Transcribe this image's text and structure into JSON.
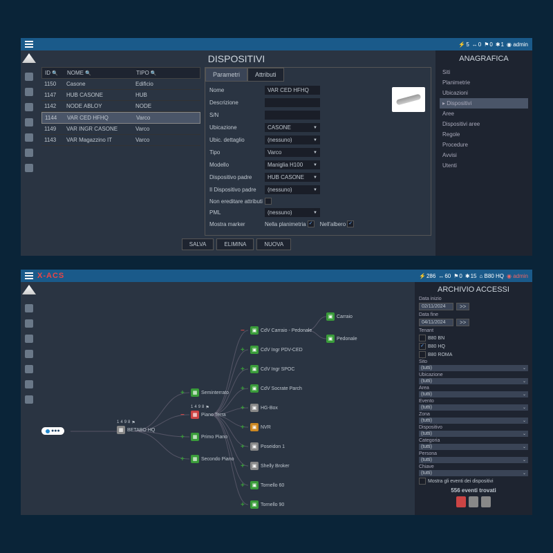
{
  "panel1": {
    "title": "DISPOSITIVI",
    "stats": {
      "b": "5",
      "s": "0",
      "f": "0",
      "e": "1"
    },
    "user": "admin",
    "table": {
      "cols": [
        "ID",
        "NOME",
        "TIPO"
      ],
      "rows": [
        {
          "id": "1150",
          "name": "Casone",
          "type": "Edificio"
        },
        {
          "id": "1147",
          "name": "HUB CASONE",
          "type": "HUB"
        },
        {
          "id": "1142",
          "name": "NODE ABLOY",
          "type": "NODE"
        },
        {
          "id": "1144",
          "name": "VAR CED HFHQ",
          "type": "Varco"
        },
        {
          "id": "1149",
          "name": "VAR INGR CASONE",
          "type": "Varco"
        },
        {
          "id": "1143",
          "name": "VAR Magazzino IT",
          "type": "Varco"
        }
      ],
      "selected": 3
    },
    "tabs": [
      "Parametri",
      "Attributi"
    ],
    "form": {
      "nome_lbl": "Nome",
      "nome_val": "VAR CED HFHQ",
      "desc_lbl": "Descrizione",
      "desc_val": "",
      "sn_lbl": "S/N",
      "sn_val": "",
      "ubic_lbl": "Ubicazione",
      "ubic_val": "CASONE",
      "ubicd_lbl": "Ubic. dettaglio",
      "ubicd_val": "(nessuno)",
      "tipo_lbl": "Tipo",
      "tipo_val": "Varco",
      "modello_lbl": "Modello",
      "modello_val": "Maniglia H100",
      "padre_lbl": "Dispositivo padre",
      "padre_val": "HUB CASONE",
      "ilpadre_lbl": "Il Dispositivo padre",
      "ilpadre_val": "(nessuno)",
      "noered_lbl": "Non ereditare attributi",
      "pml_lbl": "PML",
      "pml_val": "(nessuno)",
      "marker_lbl": "Mostra marker",
      "marker_plan": "Nella planimetria",
      "marker_tree": "Nell'albero"
    },
    "buttons": [
      "SALVA",
      "ELIMINA",
      "NUOVA"
    ],
    "anag": {
      "title": "ANAGRAFICA",
      "items": [
        "Siti",
        "Planimetrie",
        "Ubicazioni",
        "Dispositivi",
        "Aree",
        "Dispositivi aree",
        "Regole",
        "Procedure",
        "Avvisi",
        "Utenti"
      ],
      "active": 3
    }
  },
  "panel2": {
    "brand": "X-ACS",
    "stats": {
      "b": "286",
      "s": "60",
      "f": "0",
      "e": "15"
    },
    "site": "B80 HQ",
    "user": "admin",
    "tree": {
      "root": "BETABO HQ",
      "level2": [
        "Seminterrato",
        "Piano Terra",
        "Primo Piano",
        "Secondo Piano"
      ],
      "level3": [
        "CdV Carraio - Pedonale",
        "CdV Ingr PDV-CED",
        "CdV Ingr SPOC",
        "CdV Socrate Parch",
        "HG-Box",
        "NVR",
        "Poseidon 1",
        "Shelly Broker",
        "Tornello 60",
        "Tornello 90"
      ],
      "leaf": [
        "Carraio",
        "Pedonale"
      ]
    },
    "filter": {
      "title": "ARCHIVIO ACCESSI",
      "date_start_lbl": "Data inizio",
      "date_start": "02/11/2024",
      "date_end_lbl": "Data fine",
      "date_end": "04/11/2024",
      "tenant_lbl": "Tenant",
      "tenants": [
        "B80 BN",
        "B80 HQ",
        "B80 ROMA"
      ],
      "tenant_checked": 1,
      "filters": [
        {
          "label": "Sito",
          "value": "(tutti)"
        },
        {
          "label": "Ubicazione",
          "value": "(tutti)"
        },
        {
          "label": "Area",
          "value": "(tutti)"
        },
        {
          "label": "Evento",
          "value": "(tutti)"
        },
        {
          "label": "Zona",
          "value": "(tutti)"
        },
        {
          "label": "Dispositivo",
          "value": "(tutti)"
        },
        {
          "label": "Categoria",
          "value": "(tutti)"
        },
        {
          "label": "Persona",
          "value": "(tutti)"
        },
        {
          "label": "Chiave",
          "value": "(tutti)"
        }
      ],
      "show_events_lbl": "Mostra gli eventi dei dispositivi",
      "result_count": "556 eventi trovati"
    }
  }
}
